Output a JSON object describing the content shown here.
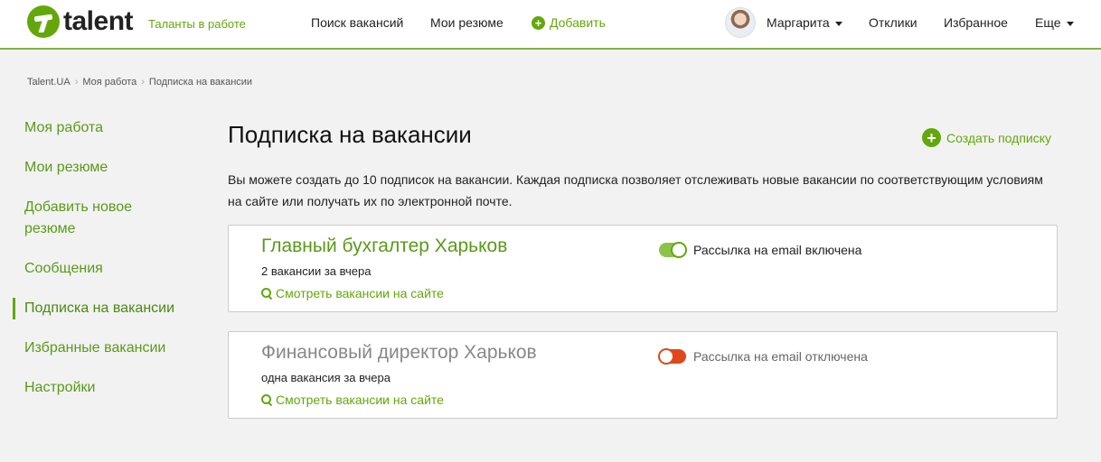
{
  "header": {
    "logo_text": "talent",
    "tagline": "Таланты в работе",
    "nav": {
      "search": "Поиск вакансий",
      "resumes": "Мои резюме",
      "add": "Добавить",
      "user": "Маргарита",
      "responses": "Отклики",
      "favorites": "Избранное",
      "more": "Еще"
    }
  },
  "breadcrumb": [
    "Talent.UA",
    "Моя работа",
    "Подписка на вакансии"
  ],
  "sidebar": {
    "items": [
      {
        "label": "Моя работа"
      },
      {
        "label": "Мои резюме"
      },
      {
        "label": "Добавить новое резюме"
      },
      {
        "label": "Сообщения"
      },
      {
        "label": "Подписка на вакансии",
        "active": true
      },
      {
        "label": "Избранные вакансии"
      },
      {
        "label": "Настройки"
      }
    ]
  },
  "main": {
    "title": "Подписка на вакансии",
    "create_label": "Создать подписку",
    "intro": "Вы можете создать до 10 подписок на вакансии. Каждая подписка позволяет отслеживать новые вакансии по соответствующим условиям на сайте или получать их по электронной почте.",
    "subscriptions": [
      {
        "title": "Главный бухгалтер Харьков",
        "count": "2 вакансии за вчера",
        "link": "Смотреть вакансии на сайте",
        "email_status": "Рассылка на email включена",
        "enabled": true,
        "title_color": "#5a9a1a"
      },
      {
        "title": "Финансовый директор Харьков",
        "count": "одна вакансия за вчера",
        "link": "Смотреть вакансии на сайте",
        "email_status": "Рассылка на email отключена",
        "enabled": false,
        "title_color": "#888888"
      }
    ]
  },
  "colors": {
    "accent": "#64a70b",
    "toggle_off": "#e0471a"
  }
}
